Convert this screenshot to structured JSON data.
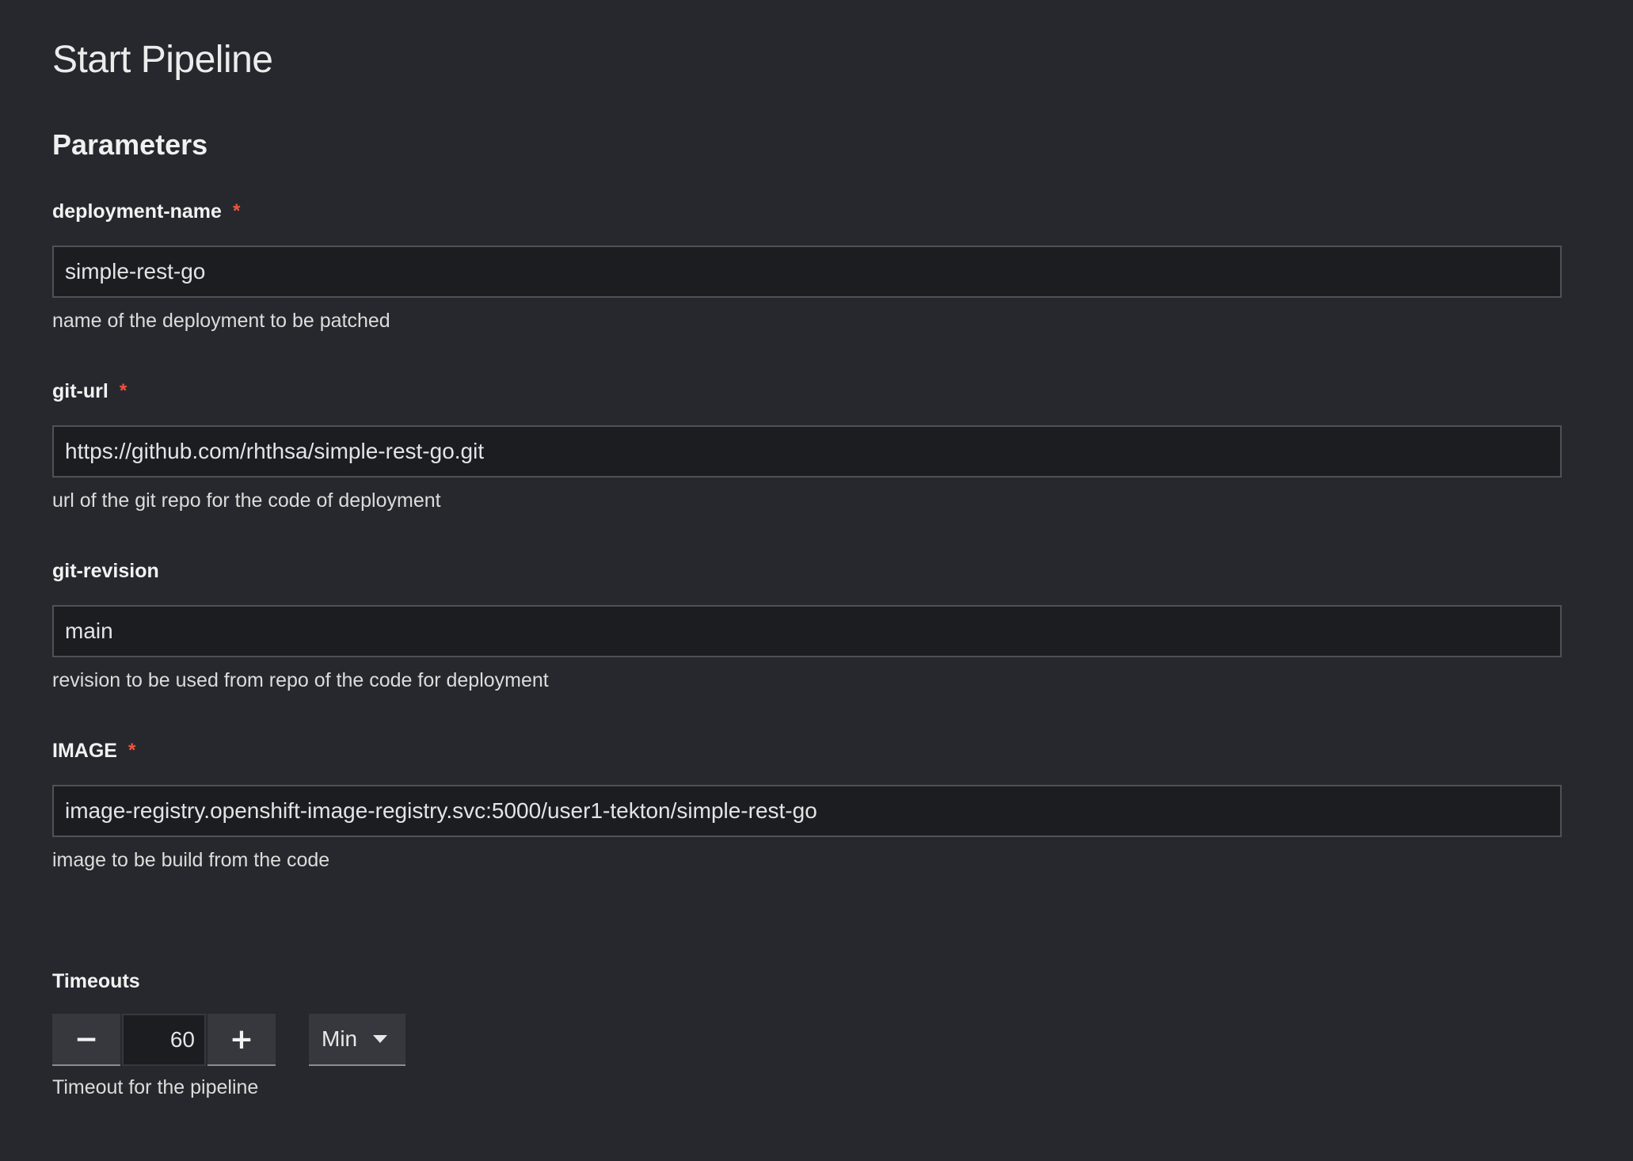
{
  "page": {
    "title": "Start Pipeline",
    "section_title": "Parameters"
  },
  "params": [
    {
      "label": "deployment-name",
      "required": true,
      "value": "simple-rest-go",
      "helper": "name of the deployment to be patched"
    },
    {
      "label": "git-url",
      "required": true,
      "value": "https://github.com/rhthsa/simple-rest-go.git",
      "helper": "url of the git repo for the code of deployment"
    },
    {
      "label": "git-revision",
      "required": false,
      "value": "main",
      "helper": "revision to be used from repo of the code for deployment"
    },
    {
      "label": "IMAGE",
      "required": true,
      "value": "image-registry.openshift-image-registry.svc:5000/user1-tekton/simple-rest-go",
      "helper": "image to be build from the code"
    }
  ],
  "required_marker": "*",
  "timeouts": {
    "label": "Timeouts",
    "minus_label": "−",
    "plus_label": "+",
    "value": "60",
    "unit": "Min",
    "helper": "Timeout for the pipeline"
  },
  "colors": {
    "background": "#26282d",
    "input_background": "#1c1d21",
    "required_star": "#f0553f"
  }
}
